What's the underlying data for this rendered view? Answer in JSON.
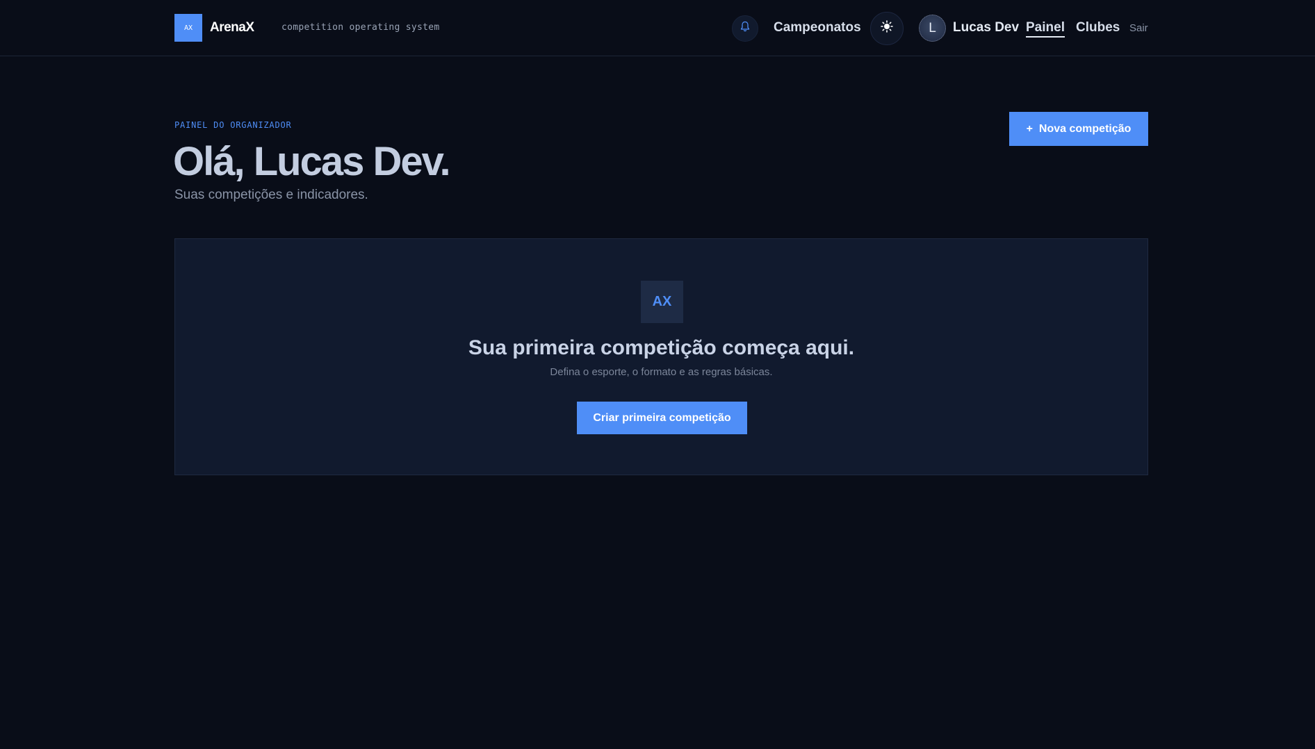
{
  "header": {
    "logo_mark": "AX",
    "brand": "ArenaX",
    "tagline": "competition operating system",
    "nav": {
      "championships": "Campeonatos",
      "panel": "Painel",
      "clubs": "Clubes",
      "logout": "Sair"
    },
    "user": {
      "initial": "L",
      "name": "Lucas Dev"
    },
    "icons": {
      "notifications": "bell-icon",
      "theme": "sun-icon"
    }
  },
  "main": {
    "eyebrow": "PAINEL DO ORGANIZADOR",
    "greeting": "Olá, Lucas Dev.",
    "subtitle": "Suas competições e indicadores.",
    "new_button": {
      "icon": "+",
      "label": "Nova competição"
    },
    "empty_state": {
      "logo_mark": "AX",
      "title": "Sua primeira competição começa aqui.",
      "description": "Defina o esporte, o formato e as regras básicas.",
      "button_label": "Criar primeira competição"
    }
  },
  "colors": {
    "background": "#090d18",
    "accent": "#4f8ef7",
    "card": "#111a2e",
    "text": "#c9d3e6"
  }
}
